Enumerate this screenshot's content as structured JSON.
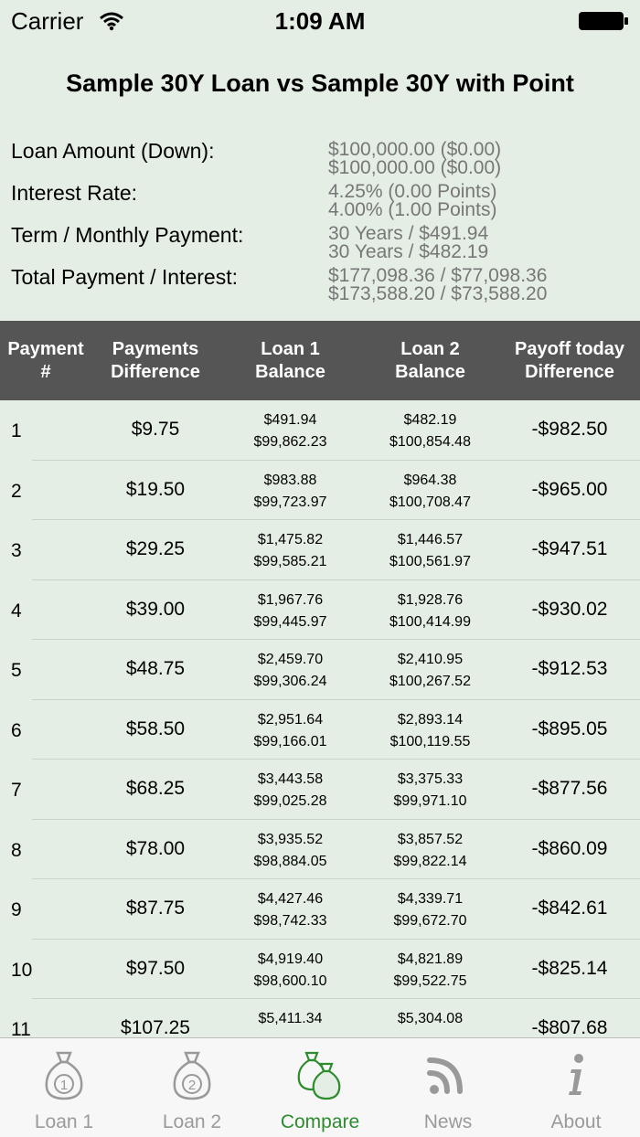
{
  "status_bar": {
    "carrier": "Carrier",
    "time": "1:09 AM"
  },
  "title": "Sample 30Y Loan vs Sample 30Y with Point",
  "summary": [
    {
      "label": "Loan Amount (Down):",
      "value1": "$100,000.00 ($0.00)",
      "value2": "$100,000.00 ($0.00)"
    },
    {
      "label": "Interest Rate:",
      "value1": "4.25% (0.00 Points)",
      "value2": "4.00% (1.00 Points)"
    },
    {
      "label": "Term / Monthly Payment:",
      "value1": "30 Years / $491.94",
      "value2": "30 Years / $482.19"
    },
    {
      "label": "Total Payment / Interest:",
      "value1": "$177,098.36 / $77,098.36",
      "value2": "$173,588.20 / $73,588.20"
    }
  ],
  "table": {
    "headers": {
      "payment_1": "Payment",
      "payment_2": "#",
      "diff_1": "Payments",
      "diff_2": "Difference",
      "loan1_1": "Loan 1",
      "loan1_2": "Balance",
      "loan2_1": "Loan 2",
      "loan2_2": "Balance",
      "payoff_1": "Payoff today",
      "payoff_2": "Difference"
    },
    "rows": [
      {
        "num": "1",
        "diff": "$9.75",
        "loan1_paid": "$491.94",
        "loan1_bal": "$99,862.23",
        "loan2_paid": "$482.19",
        "loan2_bal": "$100,854.48",
        "payoff": "-$982.50"
      },
      {
        "num": "2",
        "diff": "$19.50",
        "loan1_paid": "$983.88",
        "loan1_bal": "$99,723.97",
        "loan2_paid": "$964.38",
        "loan2_bal": "$100,708.47",
        "payoff": "-$965.00"
      },
      {
        "num": "3",
        "diff": "$29.25",
        "loan1_paid": "$1,475.82",
        "loan1_bal": "$99,585.21",
        "loan2_paid": "$1,446.57",
        "loan2_bal": "$100,561.97",
        "payoff": "-$947.51"
      },
      {
        "num": "4",
        "diff": "$39.00",
        "loan1_paid": "$1,967.76",
        "loan1_bal": "$99,445.97",
        "loan2_paid": "$1,928.76",
        "loan2_bal": "$100,414.99",
        "payoff": "-$930.02"
      },
      {
        "num": "5",
        "diff": "$48.75",
        "loan1_paid": "$2,459.70",
        "loan1_bal": "$99,306.24",
        "loan2_paid": "$2,410.95",
        "loan2_bal": "$100,267.52",
        "payoff": "-$912.53"
      },
      {
        "num": "6",
        "diff": "$58.50",
        "loan1_paid": "$2,951.64",
        "loan1_bal": "$99,166.01",
        "loan2_paid": "$2,893.14",
        "loan2_bal": "$100,119.55",
        "payoff": "-$895.05"
      },
      {
        "num": "7",
        "diff": "$68.25",
        "loan1_paid": "$3,443.58",
        "loan1_bal": "$99,025.28",
        "loan2_paid": "$3,375.33",
        "loan2_bal": "$99,971.10",
        "payoff": "-$877.56"
      },
      {
        "num": "8",
        "diff": "$78.00",
        "loan1_paid": "$3,935.52",
        "loan1_bal": "$98,884.05",
        "loan2_paid": "$3,857.52",
        "loan2_bal": "$99,822.14",
        "payoff": "-$860.09"
      },
      {
        "num": "9",
        "diff": "$87.75",
        "loan1_paid": "$4,427.46",
        "loan1_bal": "$98,742.33",
        "loan2_paid": "$4,339.71",
        "loan2_bal": "$99,672.70",
        "payoff": "-$842.61"
      },
      {
        "num": "10",
        "diff": "$97.50",
        "loan1_paid": "$4,919.40",
        "loan1_bal": "$98,600.10",
        "loan2_paid": "$4,821.89",
        "loan2_bal": "$99,522.75",
        "payoff": "-$825.14"
      },
      {
        "num": "11",
        "diff": "$107.25",
        "loan1_paid": "$5,411.34",
        "loan1_bal": "",
        "loan2_paid": "$5,304.08",
        "loan2_bal": "",
        "payoff": "-$807.68"
      }
    ]
  },
  "tab_bar": {
    "accent_color": "#2e8b2e",
    "tabs": [
      {
        "label": "Loan 1",
        "icon": "money-bag-1-icon",
        "active": false
      },
      {
        "label": "Loan 2",
        "icon": "money-bag-2-icon",
        "active": false
      },
      {
        "label": "Compare",
        "icon": "money-bags-icon",
        "active": true
      },
      {
        "label": "News",
        "icon": "rss-icon",
        "active": false
      },
      {
        "label": "About",
        "icon": "info-icon",
        "active": false
      }
    ]
  }
}
